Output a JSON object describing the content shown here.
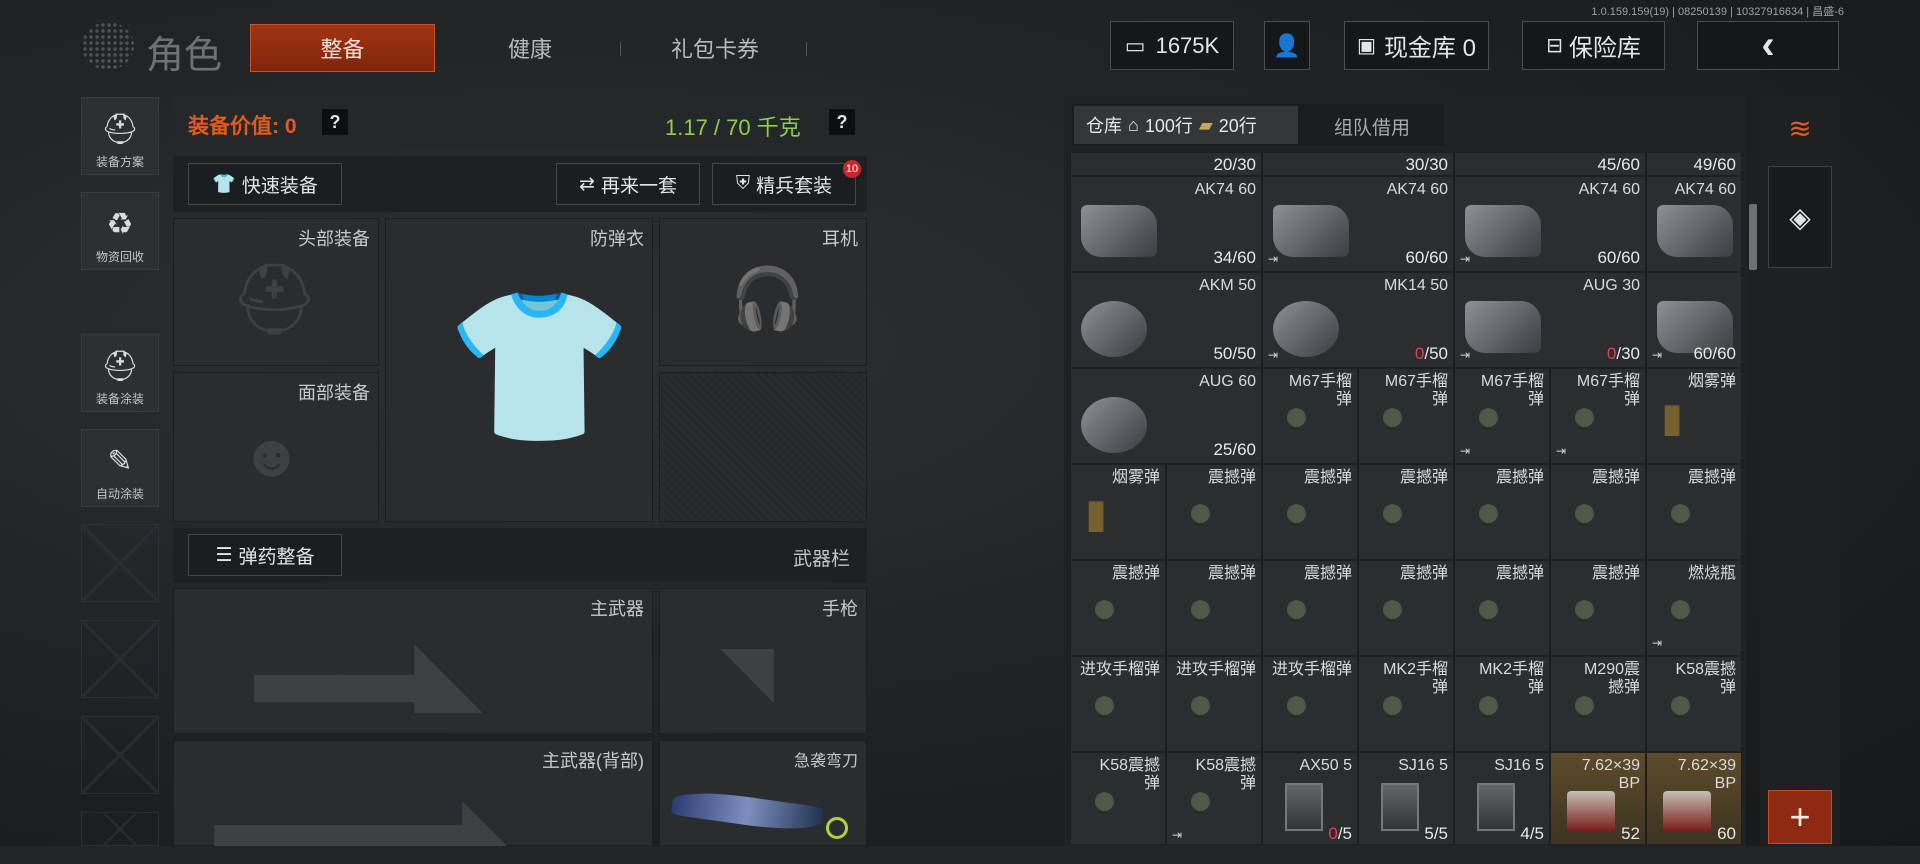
{
  "version": "1.0.159.159(19) | 08250139 | 10327916634 | 昌盛-6",
  "header": {
    "title": "角色",
    "tabs": [
      "整备",
      "健康",
      "礼包卡券"
    ],
    "money": "1675K",
    "cash_vault": "现金库 0",
    "safe": "保险库"
  },
  "sidebar": [
    "装备方案",
    "物资回收",
    "装备涂装",
    "自动涂装"
  ],
  "equip": {
    "value_label": "装备价值: 0",
    "weight": "1.17 / 70 千克",
    "quick_equip": "快速装备",
    "again": "再来一套",
    "elite": "精兵套装",
    "elite_badge": "10",
    "slots": {
      "head": "头部装备",
      "armor": "防弹衣",
      "earphone": "耳机",
      "face": "面部装备",
      "primary": "主武器",
      "pistol": "手枪",
      "primary_back": "主武器(背部)",
      "melee": "急袭弯刀"
    },
    "ammo_prep": "弹药整备",
    "weapon_bar": "武器栏"
  },
  "inventory": {
    "warehouse": "仓库",
    "rows_home": "100行",
    "rows_extra": "20行",
    "team_borrow": "组队借用",
    "grid": [
      [
        {
          "n": "",
          "c": "20/30"
        },
        {
          "n": "",
          "c": "30/30"
        },
        {
          "n": "",
          "c": "45/60"
        },
        {
          "n": "",
          "c": "49/60"
        }
      ],
      [
        {
          "n": "AK74 60",
          "c": "34/60"
        },
        {
          "n": "AK74 60",
          "c": "60/60",
          "t": true
        },
        {
          "n": "AK74 60",
          "c": "60/60",
          "t": true
        },
        {
          "n": "AK74 60",
          "c": ""
        }
      ],
      [
        {
          "n": "AKM 50",
          "c": "50/50"
        },
        {
          "n": "MK14 50",
          "c": "0/50",
          "t": true,
          "z": true
        },
        {
          "n": "AUG 30",
          "c": "0/30",
          "t": true,
          "z": true
        },
        {
          "n": "",
          "c": "60/60",
          "t": true
        }
      ],
      [
        {
          "n": "AUG 60",
          "c": "25/60"
        },
        {
          "n": "M67手榴弹",
          "c": ""
        },
        {
          "n": "M67手榴弹",
          "c": ""
        },
        {
          "n": "M67手榴弹",
          "c": "",
          "t": true
        },
        {
          "n": "M67手榴弹",
          "c": "",
          "t": true
        },
        {
          "n": "烟雾弹",
          "c": ""
        }
      ],
      [
        {
          "n": "烟雾弹",
          "c": ""
        },
        {
          "n": "震撼弹",
          "c": ""
        },
        {
          "n": "震撼弹",
          "c": ""
        },
        {
          "n": "震撼弹",
          "c": ""
        },
        {
          "n": "震撼弹",
          "c": ""
        },
        {
          "n": "震撼弹",
          "c": ""
        },
        {
          "n": "震撼弹",
          "c": ""
        }
      ],
      [
        {
          "n": "震撼弹",
          "c": ""
        },
        {
          "n": "震撼弹",
          "c": ""
        },
        {
          "n": "震撼弹",
          "c": ""
        },
        {
          "n": "震撼弹",
          "c": ""
        },
        {
          "n": "震撼弹",
          "c": ""
        },
        {
          "n": "震撼弹",
          "c": ""
        },
        {
          "n": "燃烧瓶",
          "c": "",
          "t": true
        }
      ],
      [
        {
          "n": "进攻手榴弹",
          "c": ""
        },
        {
          "n": "进攻手榴弹",
          "c": ""
        },
        {
          "n": "进攻手榴弹",
          "c": ""
        },
        {
          "n": "MK2手榴弹",
          "c": ""
        },
        {
          "n": "MK2手榴弹",
          "c": ""
        },
        {
          "n": "M290震撼弹",
          "c": ""
        },
        {
          "n": "K58震撼弹",
          "c": ""
        }
      ],
      [
        {
          "n": "K58震撼弹",
          "c": ""
        },
        {
          "n": "K58震撼弹",
          "c": "",
          "t": true
        },
        {
          "n": "AX50 5",
          "c": "0/5",
          "z": true
        },
        {
          "n": "SJ16 5",
          "c": "5/5"
        },
        {
          "n": "SJ16 5",
          "c": "4/5"
        },
        {
          "n": "7.62×39 BP",
          "c": "52",
          "g": true
        },
        {
          "n": "7.62×39 BP",
          "c": "60",
          "g": true
        }
      ]
    ]
  },
  "tool_icons": [
    "stack-refresh-icon",
    "layers-icon",
    "plus-icon"
  ]
}
